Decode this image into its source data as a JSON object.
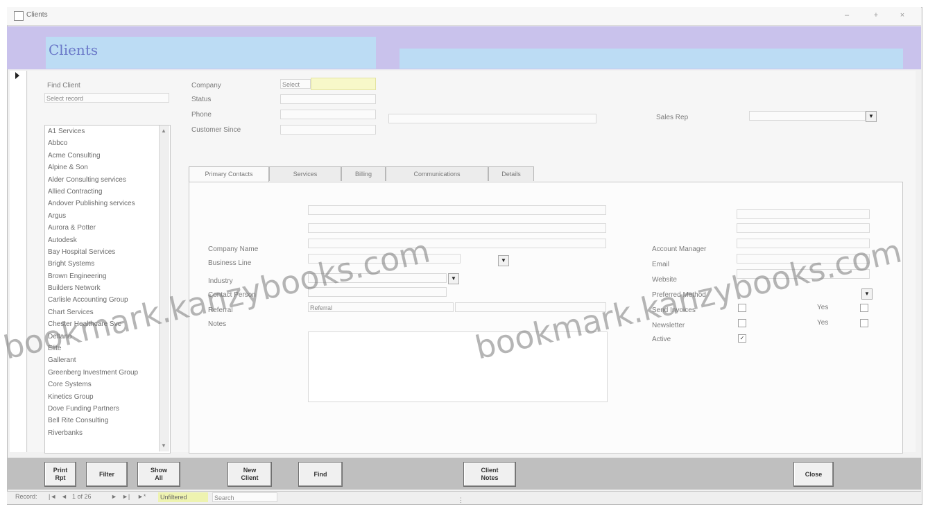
{
  "window": {
    "title": "Clients",
    "buttons": [
      "–",
      "+",
      "×"
    ]
  },
  "header": {
    "title": "Clients"
  },
  "left": {
    "search_label": "Find Client",
    "search_value": "Select record",
    "clients": [
      "A1 Services",
      "Abbco",
      "Acme Consulting",
      "Alpine & Son",
      "Alder Consulting services",
      "Allied Contracting",
      "Andover Publishing services",
      "Argus",
      "Aurora & Potter",
      "Autodesk",
      "Bay Hospital Services",
      "Bright Systems",
      "Brown Engineering",
      "Builders Network",
      "Carlisle Accounting Group",
      "Chart Services",
      "Chester Healthcare Svc",
      "Deltano",
      "Elite",
      "Gallerant",
      "Greenberg Investment Group",
      "Core Systems",
      "Kinetics Group",
      "Dove Funding Partners",
      "Bell Rite Consulting",
      "Riverbanks"
    ]
  },
  "top_fields": {
    "labels": [
      "Company",
      "Status",
      "Phone",
      "Customer Since"
    ],
    "values": [
      "Select",
      "",
      "",
      ""
    ],
    "right_label": "Sales Rep"
  },
  "tabs": [
    "Primary Contacts",
    "Services",
    "Billing",
    "Communications",
    "Details"
  ],
  "form": {
    "left_labels": [
      "",
      "Company Name",
      "Business Line",
      "Industry",
      "Contact Person",
      "Referral",
      "Notes"
    ],
    "referral_value": "Referral",
    "right_labels": [
      "",
      "Account Manager",
      "Email",
      "Website",
      "Preferred Method",
      "Send Invoices",
      "Newsletter",
      "Active"
    ],
    "right_values": [
      "Yes",
      "Yes"
    ]
  },
  "footer_buttons": [
    "Print\nRpt",
    "Filter",
    "Show\nAll",
    "New\nClient",
    "Find",
    "Client\nNotes",
    "Close"
  ],
  "navigation": {
    "record_prefix": "Record:",
    "record_of": "1 of 26",
    "filter_label": "Unfiltered",
    "search_label": "Search"
  },
  "watermark": [
    "bookmark.kanzybooks.com",
    "bookmark.kanzybooks.com"
  ]
}
